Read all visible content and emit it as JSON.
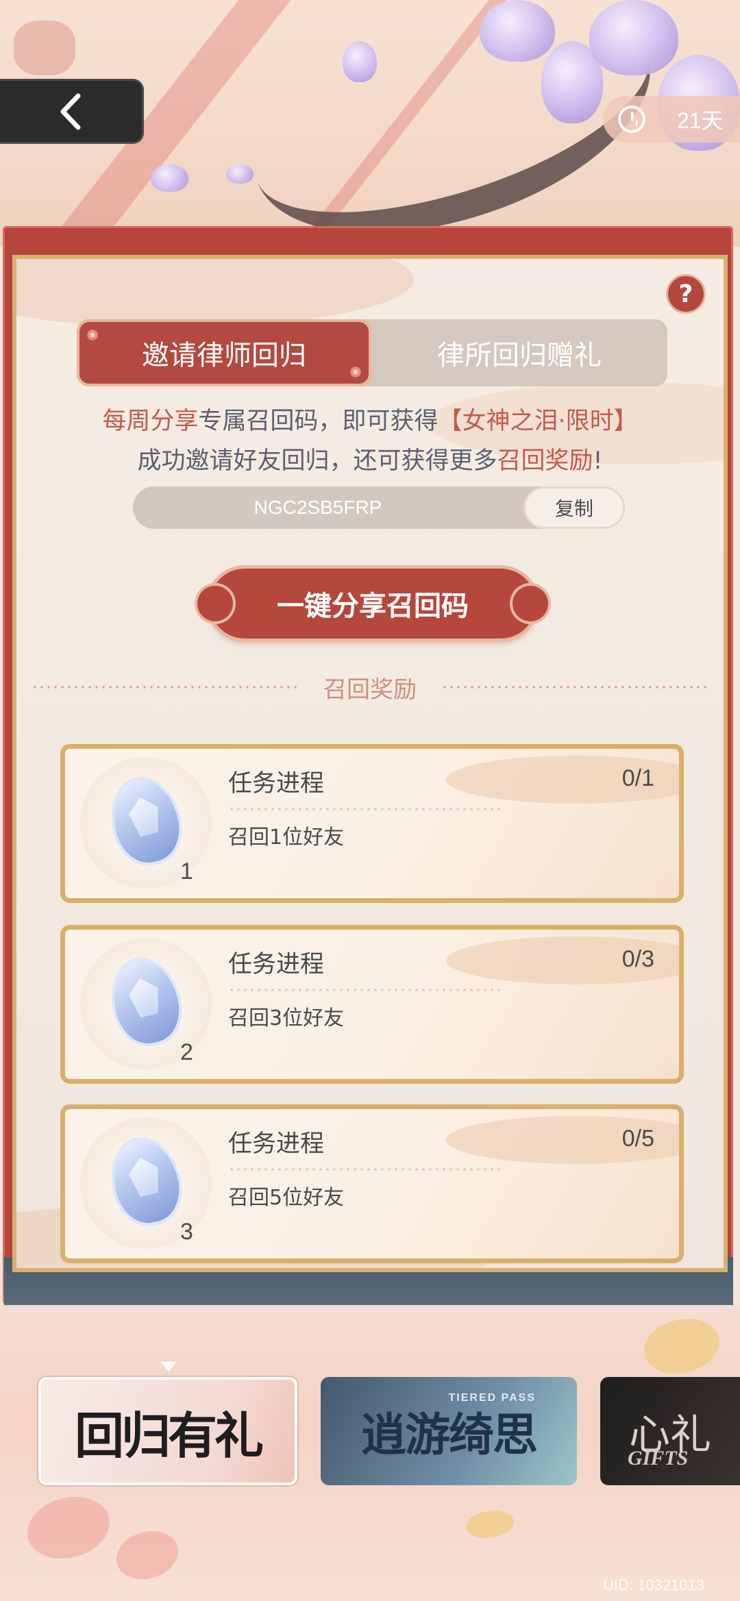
{
  "header": {
    "countdown": "21天"
  },
  "tabs": [
    {
      "label": "邀请律师回归",
      "active": true
    },
    {
      "label": "律所回归赠礼",
      "active": false
    }
  ],
  "intro": {
    "line1_a": "每周分享",
    "line1_b": "专属召回码，即可获得",
    "line1_c": "【女神之泪·限时】",
    "line2_a": "成功邀请好友回归，还可获得更多",
    "line2_b": "召回奖励",
    "line2_c": "!"
  },
  "code": {
    "value": "NGC2SB5FRP",
    "copy_label": "复制"
  },
  "share_button": "一键分享召回码",
  "rewards_title": "召回奖励",
  "tasks": [
    {
      "title": "任务进程",
      "progress": "0/1",
      "desc": "召回1位好友",
      "reward_count": "1"
    },
    {
      "title": "任务进程",
      "progress": "0/3",
      "desc": "召回3位好友",
      "reward_count": "2"
    },
    {
      "title": "任务进程",
      "progress": "0/5",
      "desc": "召回5位好友",
      "reward_count": "3"
    }
  ],
  "banners": [
    {
      "label": "回归有礼",
      "sub": ""
    },
    {
      "label": "逍游绮思",
      "sub": "TIERED PASS"
    },
    {
      "label": "心礼",
      "sub": "GIFTS"
    }
  ],
  "uid": "UID: 10321013",
  "colors": {
    "primary_red": "#b6473d",
    "gold_border": "#d7b06a",
    "text_dark": "#4a4a4a",
    "accent_text": "#c55a4b"
  }
}
